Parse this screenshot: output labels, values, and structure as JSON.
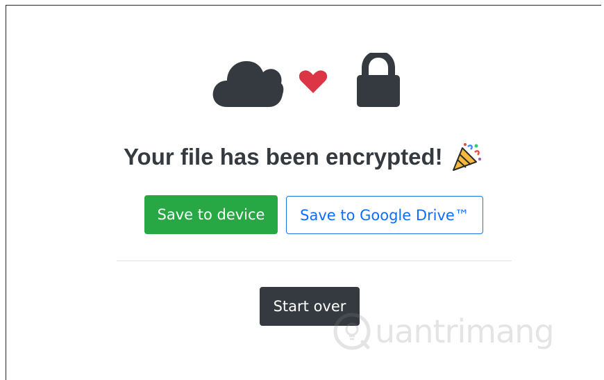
{
  "icons": {
    "cloud": "cloud-icon",
    "heart": "heart-icon",
    "lock": "lock-icon",
    "party": "party-popper-icon"
  },
  "colors": {
    "dark": "#343a40",
    "heart": "#dc3545",
    "success": "#28a745",
    "primary": "#0d6efd"
  },
  "message": {
    "title": "Your file has been encrypted!"
  },
  "actions": {
    "save_device_label": "Save to device",
    "save_drive_label": "Save to Google Drive™",
    "start_over_label": "Start over"
  },
  "watermark": {
    "text": "uantrimang"
  }
}
